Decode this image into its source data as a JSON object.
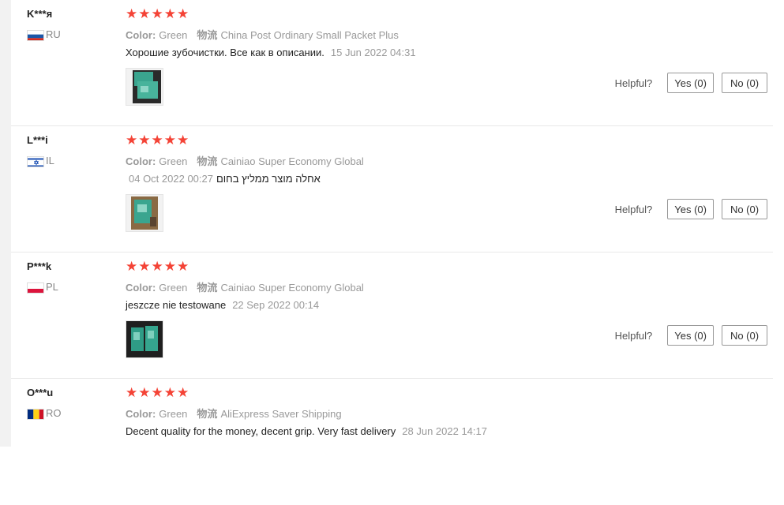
{
  "labels": {
    "color": "Color:",
    "shipping": "物流",
    "helpful": "Helpful?"
  },
  "colors": {
    "star": "#f44336",
    "muted": "#999999"
  },
  "reviews": [
    {
      "user": "K***я",
      "country": "RU",
      "flag": "russia-flag-icon",
      "stars": 5,
      "color_value": "Green",
      "shipping_value": "China Post Ordinary Small Packet Plus",
      "text": "Хорошие зубочистки. Все как в описании.",
      "date": "15 Jun 2022 04:31",
      "yes": "Yes (0)",
      "no": "No (0)"
    },
    {
      "user": "L***i",
      "country": "IL",
      "flag": "israel-flag-icon",
      "stars": 5,
      "color_value": "Green",
      "shipping_value": "Cainiao Super Economy Global",
      "text": "אחלה מוצר ממליץ בחום",
      "date": "04 Oct 2022 00:27",
      "yes": "Yes (0)",
      "no": "No (0)"
    },
    {
      "user": "P***k",
      "country": "PL",
      "flag": "poland-flag-icon",
      "stars": 5,
      "color_value": "Green",
      "shipping_value": "Cainiao Super Economy Global",
      "text": "jeszcze nie testowane",
      "date": "22 Sep 2022 00:14",
      "yes": "Yes (0)",
      "no": "No (0)"
    },
    {
      "user": "O***u",
      "country": "RO",
      "flag": "romania-flag-icon",
      "stars": 5,
      "color_value": "Green",
      "shipping_value": "AliExpress Saver Shipping",
      "text": "Decent quality for the money, decent grip. Very fast delivery",
      "date": "28 Jun 2022 14:17"
    }
  ]
}
